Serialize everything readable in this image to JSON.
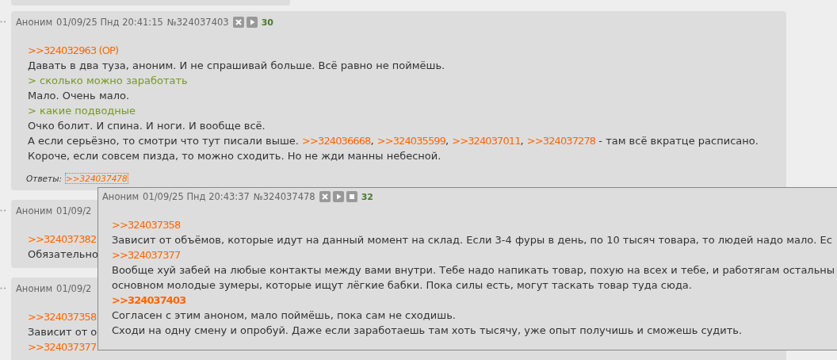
{
  "posts": [
    {
      "author": "Аноним",
      "date": "01/09/25 Пнд 20:41:15",
      "number": "№324037403",
      "buttons": [
        {
          "kind": "hide"
        },
        {
          "kind": "play"
        }
      ],
      "count": "30",
      "lines": [
        {
          "segments": [
            {
              "kind": "link",
              "text": ">>324032963 (OP)"
            }
          ]
        },
        {
          "segments": [
            {
              "kind": "text",
              "text": "Давать в два туза, аноним. И не спрашивай больше. Всё равно не поймёшь."
            }
          ]
        },
        {
          "segments": [
            {
              "kind": "quote",
              "text": "> сколько можно заработать"
            }
          ]
        },
        {
          "segments": [
            {
              "kind": "text",
              "text": "Мало. Очень мало."
            }
          ]
        },
        {
          "segments": [
            {
              "kind": "quote",
              "text": "> какие подводные"
            }
          ]
        },
        {
          "segments": [
            {
              "kind": "text",
              "text": "Очко болит. И спина. И ноги. И вообще всё."
            }
          ]
        },
        {
          "segments": [
            {
              "kind": "text",
              "text": "А если серьёзно, то смотри что тут писали выше. "
            },
            {
              "kind": "link",
              "text": ">>324036668"
            },
            {
              "kind": "text",
              "text": ", "
            },
            {
              "kind": "link",
              "text": ">>324035599"
            },
            {
              "kind": "text",
              "text": ", "
            },
            {
              "kind": "link",
              "text": ">>324037011"
            },
            {
              "kind": "text",
              "text": ", "
            },
            {
              "kind": "link",
              "text": ">>324037278"
            },
            {
              "kind": "text",
              "text": " - там всё вкратце расписано."
            }
          ]
        },
        {
          "segments": [
            {
              "kind": "text",
              "text": "Короче, если совсем пизда, то можно сходить. Но не жди манны небесной."
            }
          ]
        }
      ],
      "replies": {
        "label": "Ответы:",
        "links": [
          {
            "text": ">>324037478",
            "hovered": true
          }
        ]
      }
    },
    {
      "author": "Аноним",
      "date": "01/09/2",
      "lines": [
        {
          "segments": [
            {
              "kind": "link",
              "text": ">>324037382"
            }
          ]
        },
        {
          "segments": [
            {
              "kind": "text",
              "text": "Обязательно"
            }
          ]
        }
      ]
    },
    {
      "author": "Аноним",
      "date": "01/09/2",
      "lines": [
        {
          "segments": [
            {
              "kind": "link",
              "text": ">>324037358"
            }
          ]
        },
        {
          "segments": [
            {
              "kind": "text",
              "text": "Зависит от о"
            }
          ]
        },
        {
          "segments": [
            {
              "kind": "link",
              "text": ">>324037377"
            }
          ]
        }
      ]
    }
  ],
  "popup": {
    "author": "Аноним",
    "date": "01/09/25 Пнд 20:43:37",
    "number": "№324037478",
    "buttons": [
      {
        "kind": "hide"
      },
      {
        "kind": "play"
      },
      {
        "kind": "stop"
      }
    ],
    "count": "32",
    "lines": [
      {
        "segments": [
          {
            "kind": "link",
            "text": ">>324037358"
          }
        ]
      },
      {
        "segments": [
          {
            "kind": "text",
            "text": "Зависит от объёмов, которые идут на данный момент на склад. Если 3-4 фуры в день, по 10 тысяч товара, то людей надо мало. Ес"
          }
        ]
      },
      {
        "segments": [
          {
            "kind": "link",
            "text": ">>324037377"
          }
        ]
      },
      {
        "segments": [
          {
            "kind": "text",
            "text": "Вообще хуй забей на любые контакты между вами внутри. Тебе надо напикать товар, похую на всех и тебе, и работягам остальны"
          }
        ]
      },
      {
        "segments": [
          {
            "kind": "text",
            "text": "основном молодые зумеры, которые ищут лёгкие бабки. Пока силы есть, могут таскать товар туда сюда."
          }
        ]
      },
      {
        "segments": [
          {
            "kind": "link",
            "text": ">>324037403",
            "highlighted": true
          }
        ]
      },
      {
        "segments": [
          {
            "kind": "text",
            "text": "Согласен с этим аноном, мало поймёшь, пока сам не сходишь."
          }
        ]
      },
      {
        "segments": [
          {
            "kind": "text",
            "text": "Сходи на одну смену и опробуй. Даже если заработаешь там хоть тысячу, уже опыт получишь и сможешь судить."
          }
        ]
      }
    ]
  }
}
